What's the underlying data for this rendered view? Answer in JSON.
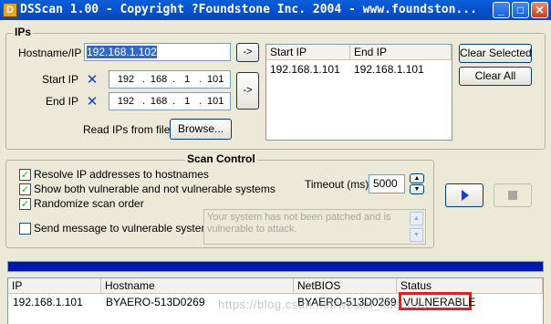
{
  "window": {
    "title": "DSScan 1.00 - Copyright ?Foundstone Inc. 2004 - www.foundston...",
    "app_icon": "D",
    "minimize": "_",
    "maximize": "□",
    "close": "✕"
  },
  "ips": {
    "group_title": "IPs",
    "hostname_label": "Hostname/IP",
    "hostname_value": "192.168.1.102",
    "start_ip_label": "Start IP",
    "end_ip_label": "End IP",
    "start_ip": [
      "192",
      "168",
      "1",
      "101"
    ],
    "end_ip": [
      "192",
      "168",
      "1",
      "101"
    ],
    "arrow_button": "->",
    "read_from_file_label": "Read IPs from file",
    "browse_button": "Browse...",
    "list_headers": [
      "Start IP",
      "End IP"
    ],
    "list_rows": [
      [
        "192.168.1.101",
        "192.168.1.101"
      ]
    ],
    "clear_selected_button": "Clear Selected",
    "clear_all_button": "Clear All"
  },
  "scan_control": {
    "group_title": "Scan Control",
    "options": [
      {
        "label": "Resolve IP addresses to hostnames",
        "checked": true
      },
      {
        "label": "Show both vulnerable and not vulnerable systems",
        "checked": true
      },
      {
        "label": "Randomize scan order",
        "checked": true
      },
      {
        "label": "Send message to vulnerable systems",
        "checked": false
      }
    ],
    "timeout_label": "Timeout (ms)",
    "timeout_value": "5000",
    "message_text": "Your system has not been patched and is vulnerable to attack.",
    "start_icon": "play-icon",
    "stop_icon": "stop-icon"
  },
  "results": {
    "headers": [
      "IP",
      "Hostname",
      "NetBIOS",
      "Status"
    ],
    "rows": [
      [
        "192.168.1.101",
        "BYAERO-513D0269",
        "BYAERO-513D0269",
        "VULNERABLE"
      ]
    ],
    "watermark": "https://blog.csdn.net/weixin_xuechao"
  },
  "colors": {
    "titlebar": "#0553d0",
    "progress": "#0018a8",
    "highlight": "#e02020"
  }
}
